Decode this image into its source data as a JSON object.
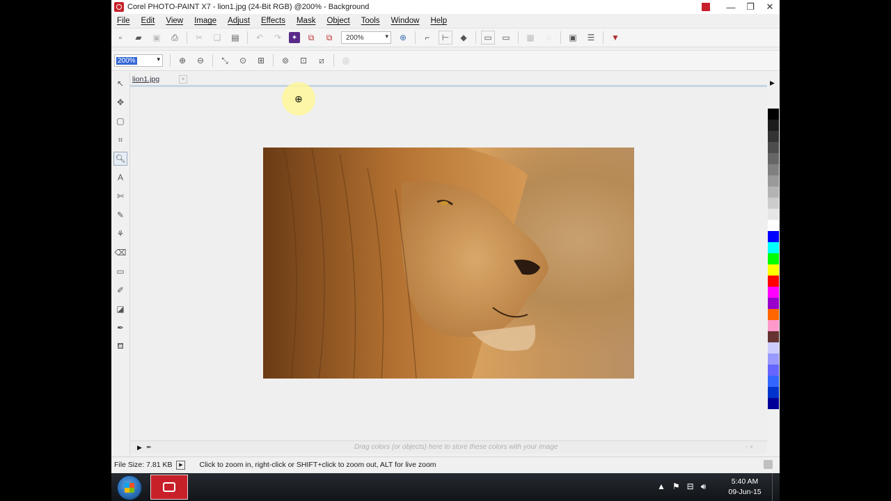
{
  "window": {
    "title": "Corel PHOTO-PAINT X7 - lion1.jpg (24-Bit RGB) @200% - Background"
  },
  "menu": [
    "File",
    "Edit",
    "View",
    "Image",
    "Adjust",
    "Effects",
    "Mask",
    "Object",
    "Tools",
    "Window",
    "Help"
  ],
  "toolbar": {
    "zoom_value": "200%"
  },
  "property_bar": {
    "zoom_value": "200%"
  },
  "document": {
    "tab_label": "lion1.jpg"
  },
  "color_tray": {
    "hint": "Drag colors (or objects) here to store these colors with your image"
  },
  "status": {
    "file_size": "File Size: 7.81 KB",
    "message": "Click to zoom in, right-click or SHIFT+click to zoom out, ALT for live zoom"
  },
  "taskbar": {
    "time": "5:40 AM",
    "date": "09-Jun-15"
  },
  "palette": [
    "#000000",
    "#1c1c1c",
    "#333333",
    "#4d4d4d",
    "#666666",
    "#808080",
    "#999999",
    "#b3b3b3",
    "#cccccc",
    "#e6e6e6",
    "#ffffff",
    "#0000ff",
    "#00ffff",
    "#00ff00",
    "#ffff00",
    "#ff0000",
    "#ff00ff",
    "#9900cc",
    "#ff6600",
    "#ff99cc",
    "#663333",
    "#ccccff",
    "#9999ff",
    "#6666ff",
    "#3366ff",
    "#0033cc",
    "#000099"
  ]
}
